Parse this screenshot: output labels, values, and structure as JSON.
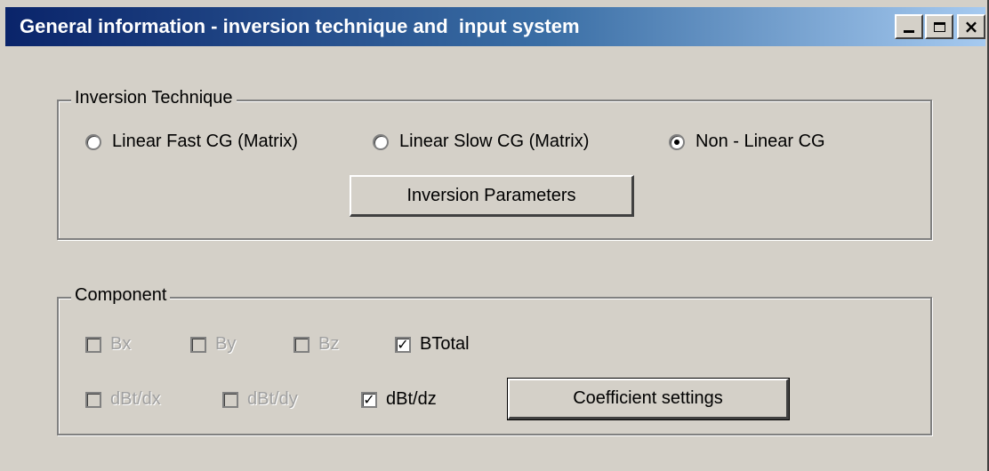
{
  "window": {
    "title": "General information - inversion technique and  input system",
    "buttons": {
      "minimize": "_",
      "maximize": "□",
      "close": "×"
    }
  },
  "inversion_group": {
    "legend": "Inversion Technique",
    "options": [
      {
        "label": "Linear Fast CG (Matrix)",
        "selected": false
      },
      {
        "label": "Linear Slow CG (Matrix)",
        "selected": false
      },
      {
        "label": "Non - Linear CG",
        "selected": true
      }
    ],
    "parameters_button": "Inversion Parameters"
  },
  "component_group": {
    "legend": "Component",
    "checkboxes": [
      {
        "label": "Bx",
        "checked": false,
        "enabled": false
      },
      {
        "label": "By",
        "checked": false,
        "enabled": false
      },
      {
        "label": "Bz",
        "checked": false,
        "enabled": false
      },
      {
        "label": "BTotal",
        "checked": true,
        "enabled": true
      },
      {
        "label": "dBt/dx",
        "checked": false,
        "enabled": false
      },
      {
        "label": "dBt/dy",
        "checked": false,
        "enabled": false
      },
      {
        "label": "dBt/dz",
        "checked": true,
        "enabled": true
      }
    ],
    "coefficient_button": "Coefficient settings",
    "check_mark": "✓"
  }
}
